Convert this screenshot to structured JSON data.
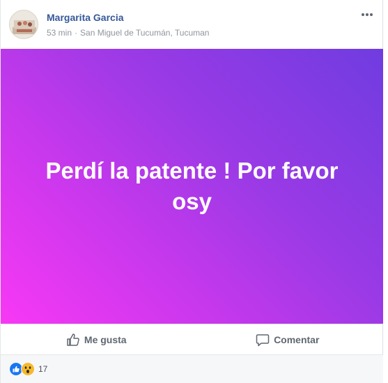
{
  "post": {
    "author": "Margarita Garcia",
    "time": "53 min",
    "separator": "·",
    "location": "San Miguel de Tucumán, Tucuman",
    "text": "Perdí la patente ! Por favor osy"
  },
  "actions": {
    "like_label": "Me gusta",
    "comment_label": "Comentar"
  },
  "reactions": {
    "count": "17",
    "types": [
      "like-icon",
      "wow-icon"
    ]
  },
  "colors": {
    "author_link": "#365899",
    "gradient_start": "#f838f5",
    "gradient_end": "#6f3ce0",
    "like_blue": "#1877f2",
    "wow_yellow": "#f7b928"
  }
}
